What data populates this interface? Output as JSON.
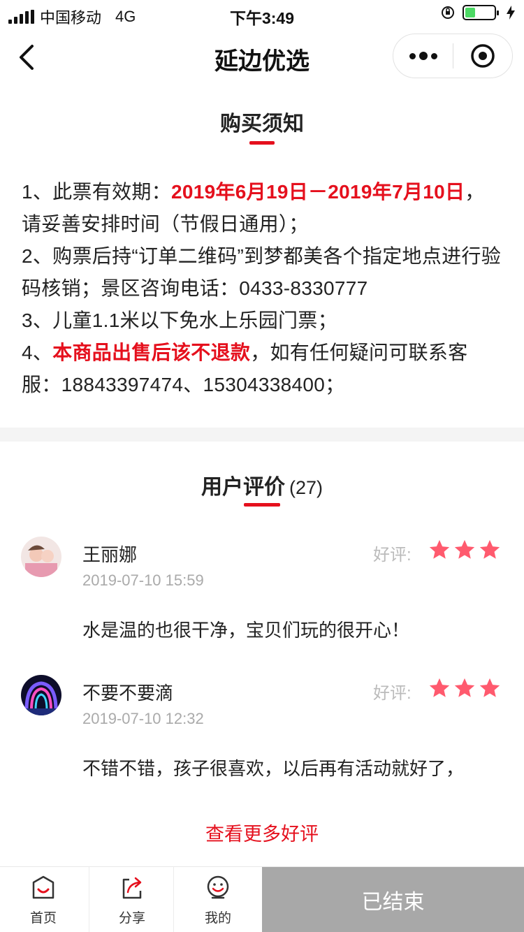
{
  "status_bar": {
    "carrier": "中国移动",
    "network": "4G",
    "time": "下午3:49"
  },
  "nav": {
    "title": "延边优选"
  },
  "notice": {
    "heading": "购买须知",
    "line1_prefix": "1、此票有效期：",
    "line1_highlight": "2019年6月19日－2019年7月10日",
    "line1_suffix": "，请妥善安排时间（节假日通用）；",
    "line2": "2、购票后持“订单二维码”到梦都美各个指定地点进行验码核销；景区咨询电话：0433-8330777",
    "line3": "3、儿童1.1米以下免水上乐园门票；",
    "line4_prefix": "4、",
    "line4_highlight": "本商品出售后该不退款",
    "line4_suffix": "，如有任何疑问可联系客服：18843397474、15304338400；"
  },
  "reviews": {
    "heading": "用户评价",
    "count": "(27)",
    "items": [
      {
        "name": "王丽娜",
        "date": "2019-07-10 15:59",
        "grade_label": "好评:",
        "stars": 3,
        "text": "水是温的也很干净，宝贝们玩的很开心！"
      },
      {
        "name": "不要不要滴",
        "date": "2019-07-10 12:32",
        "grade_label": "好评:",
        "stars": 3,
        "text": "不错不错，孩子很喜欢，以后再有活动就好了，"
      }
    ],
    "more_link": "查看更多好评"
  },
  "tabbar": {
    "home": "首页",
    "share": "分享",
    "mine": "我的",
    "action": "已结束"
  },
  "colors": {
    "accent": "#e5101d",
    "star": "#ff5a6e",
    "disabled_button": "#a8a8a8"
  }
}
